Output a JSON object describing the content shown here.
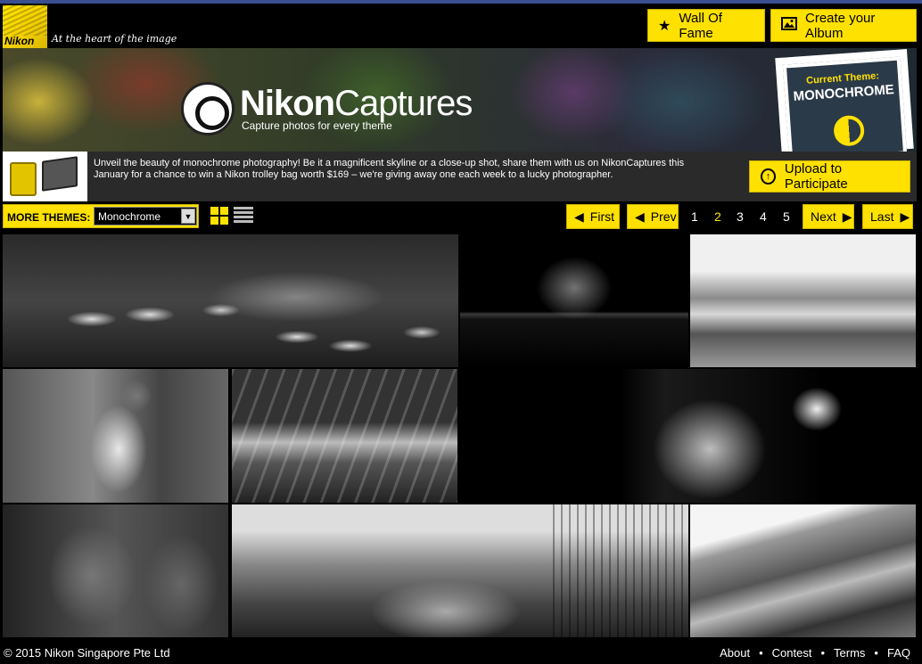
{
  "header": {
    "logo_text": "Nikon",
    "tagline": "At the heart of the image",
    "wall_of_fame_label": "Wall Of Fame",
    "create_album_label": "Create your Album"
  },
  "banner": {
    "brand_bold": "Nikon",
    "brand_light": "Captures",
    "subtitle": "Capture photos for every theme",
    "current_theme_label": "Current Theme:",
    "current_theme_value": "MONOCHROME"
  },
  "info": {
    "description": "Unveil the beauty of monochrome photography! Be it a magnificent skyline or a close-up shot, share them with us on NikonCaptures this January for a chance to win a Nikon trolley bag worth $169 – we're giving away one each week to a lucky photographer.",
    "upload_label": "Upload to Participate"
  },
  "themes": {
    "label": "MORE THEMES:",
    "selected": "Monochrome"
  },
  "pagination": {
    "first": "First",
    "prev": "Prev",
    "pages": [
      "1",
      "2",
      "3",
      "4",
      "5"
    ],
    "current": "2",
    "next": "Next",
    "last": "Last"
  },
  "footer": {
    "copyright": "© 2015 Nikon Singapore Pte Ltd",
    "links": [
      "About",
      "Contest",
      "Terms",
      "FAQ"
    ]
  },
  "icons": {
    "wall_of_fame": "star-icon",
    "create_album": "image-icon",
    "upload": "upload-arrow-icon",
    "view_grid": "grid-view-icon",
    "view_list": "list-view-icon"
  },
  "colors": {
    "accent": "#ffe100",
    "background": "#000000",
    "top_bar": "#3a4f8f"
  }
}
